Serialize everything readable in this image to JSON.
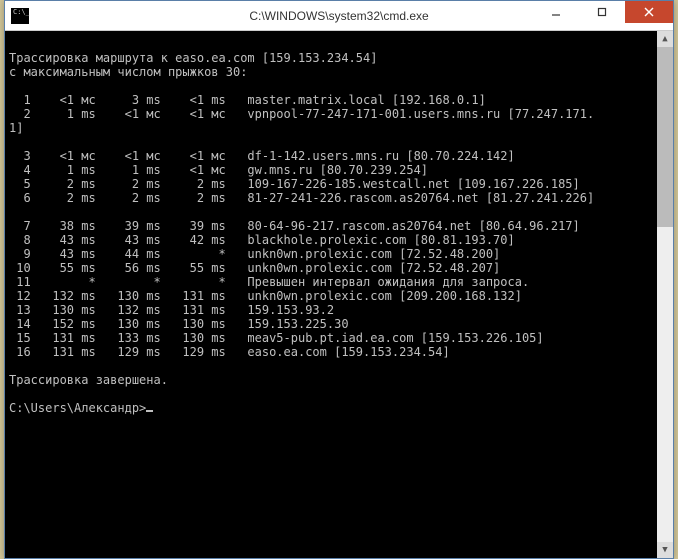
{
  "titlebar": {
    "title": "C:\\WINDOWS\\system32\\cmd.exe"
  },
  "trace": {
    "header1": "Трассировка маршрута к easo.ea.com [159.153.234.54]",
    "header2": "с максимальным числом прыжков 30:",
    "footer": "Трассировка завершена.",
    "prompt": "C:\\Users\\Александр>",
    "hops": [
      {
        "n": "1",
        "t1": "<1 мс",
        "t2": "3 ms",
        "t3": "<1 ms",
        "host": "master.matrix.local [192.168.0.1]"
      },
      {
        "n": "2",
        "t1": "1 ms",
        "t2": "<1 мс",
        "t3": "<1 мс",
        "host": "vpnpool-77-247-171-001.users.mns.ru [77.247.171.1]"
      },
      {
        "n": "3",
        "t1": "<1 мс",
        "t2": "<1 мс",
        "t3": "<1 мс",
        "host": "df-1-142.users.mns.ru [80.70.224.142]"
      },
      {
        "n": "4",
        "t1": "1 ms",
        "t2": "1 ms",
        "t3": "<1 мс",
        "host": "gw.mns.ru [80.70.239.254]"
      },
      {
        "n": "5",
        "t1": "2 ms",
        "t2": "2 ms",
        "t3": "2 ms",
        "host": "109-167-226-185.westcall.net [109.167.226.185]"
      },
      {
        "n": "6",
        "t1": "2 ms",
        "t2": "2 ms",
        "t3": "2 ms",
        "host": "81-27-241-226.rascom.as20764.net [81.27.241.226]"
      },
      {
        "n": "7",
        "t1": "38 ms",
        "t2": "39 ms",
        "t3": "39 ms",
        "host": "80-64-96-217.rascom.as20764.net [80.64.96.217]"
      },
      {
        "n": "8",
        "t1": "43 ms",
        "t2": "43 ms",
        "t3": "42 ms",
        "host": "blackhole.prolexic.com [80.81.193.70]"
      },
      {
        "n": "9",
        "t1": "43 ms",
        "t2": "44 ms",
        "t3": "*",
        "host": "unkn0wn.prolexic.com [72.52.48.200]"
      },
      {
        "n": "10",
        "t1": "55 ms",
        "t2": "56 ms",
        "t3": "55 ms",
        "host": "unkn0wn.prolexic.com [72.52.48.207]"
      },
      {
        "n": "11",
        "t1": "*",
        "t2": "*",
        "t3": "*",
        "host": "Превышен интервал ожидания для запроса."
      },
      {
        "n": "12",
        "t1": "132 ms",
        "t2": "130 ms",
        "t3": "131 ms",
        "host": "unkn0wn.prolexic.com [209.200.168.132]"
      },
      {
        "n": "13",
        "t1": "130 ms",
        "t2": "132 ms",
        "t3": "131 ms",
        "host": "159.153.93.2"
      },
      {
        "n": "14",
        "t1": "152 ms",
        "t2": "130 ms",
        "t3": "130 ms",
        "host": "159.153.225.30"
      },
      {
        "n": "15",
        "t1": "131 ms",
        "t2": "133 ms",
        "t3": "130 ms",
        "host": "meav5-pub.pt.iad.ea.com [159.153.226.105]"
      },
      {
        "n": "16",
        "t1": "131 ms",
        "t2": "129 ms",
        "t3": "129 ms",
        "host": "easo.ea.com [159.153.234.54]"
      }
    ]
  }
}
